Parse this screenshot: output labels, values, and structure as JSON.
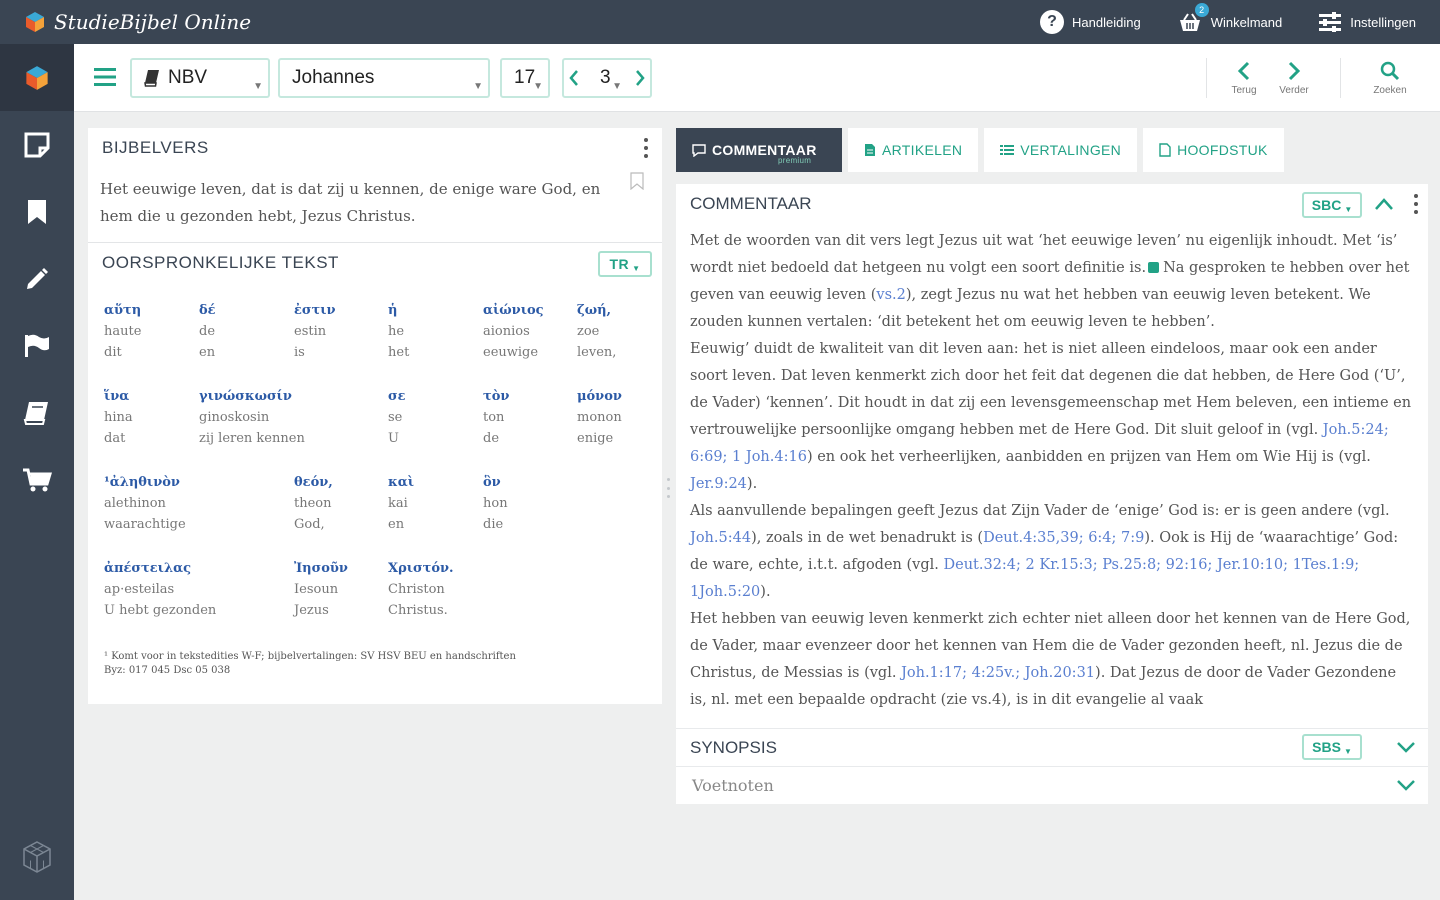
{
  "app": {
    "title": "StudieBijbel Online"
  },
  "topbar": {
    "help_label": "Handleiding",
    "cart_label": "Winkelmand",
    "cart_count": "2",
    "settings_label": "Instellingen"
  },
  "sidebar": {
    "items": [
      "logo",
      "notes",
      "bookmarks",
      "edit",
      "flag",
      "books",
      "cart"
    ]
  },
  "toolbar": {
    "translation": "NBV",
    "book": "Johannes",
    "chapter": "17",
    "verse": "3",
    "back_label": "Terug",
    "forward_label": "Verder",
    "search_label": "Zoeken"
  },
  "left": {
    "verse_title": "BIJBELVERS",
    "verse_text": "Het eeuwige leven, dat is dat zij u kennen, de enige ware God, en hem die u gezonden hebt, Jezus Christus.",
    "orig_title": "OORSPRONKELIJKE TEKST",
    "orig_badge": "TR",
    "words": [
      {
        "g": "αὕτη",
        "t": "haute",
        "d": "dit"
      },
      {
        "g": "δέ",
        "t": "de",
        "d": "en"
      },
      {
        "g": "ἐστιν",
        "t": "estin",
        "d": "is"
      },
      {
        "g": "ἡ",
        "t": "he",
        "d": "het"
      },
      {
        "g": "αἰώνιος",
        "t": "aionios",
        "d": "eeuwige"
      },
      {
        "g": "ζωή,",
        "t": "zoe",
        "d": "leven,"
      },
      {
        "g": "ἵνα",
        "t": "hina",
        "d": "dat"
      },
      {
        "g": "γινώσκωσίν",
        "t": "ginoskosin",
        "d": "zij leren kennen"
      },
      {
        "g": "σε",
        "t": "se",
        "d": "U"
      },
      {
        "g": "τὸν",
        "t": "ton",
        "d": "de"
      },
      {
        "g": "μόνον",
        "t": "monon",
        "d": "enige"
      },
      {
        "g": "¹ἀληθινὸν",
        "t": "alethinon",
        "d": "waarachtige"
      },
      {
        "g": "θεόν,",
        "t": "theon",
        "d": "God,"
      },
      {
        "g": "καὶ",
        "t": "kai",
        "d": "en"
      },
      {
        "g": "ὃν",
        "t": "hon",
        "d": "die"
      },
      {
        "g": "ἀπέστειλας",
        "t": "ap·esteilas",
        "d": "U hebt gezonden"
      },
      {
        "g": "Ἰησοῦν",
        "t": "Iesoun",
        "d": "Jezus"
      },
      {
        "g": "Χριστόν.",
        "t": "Christon",
        "d": "Christus."
      }
    ],
    "footnote": "¹ Komt voor in tekstedities W-F; bijbelvertalingen: SV HSV BEU en handschriften Byz: 017 045 Dsc 05 038"
  },
  "tabs": [
    {
      "label": "COMMENTAAR",
      "sub": "premium"
    },
    {
      "label": "ARTIKELEN"
    },
    {
      "label": "VERTALINGEN"
    },
    {
      "label": "HOOFDSTUK"
    }
  ],
  "commentary": {
    "title": "COMMENTAAR",
    "badge": "SBC",
    "p1a": "Met de woorden van dit vers legt Jezus uit wat ‘het eeuwige leven’ nu eigenlijk inhoudt. Met ‘is’ wordt niet bedoeld dat hetgeen nu volgt een soort definitie is.",
    "p1b": "Na gesproken te hebben over het geven van eeuwig leven (",
    "p1_link": "vs.2",
    "p1c": "), zegt Jezus nu wat het hebben van eeuwig leven betekent. We zouden kunnen vertalen: ‘dit betekent het om eeuwig leven te hebben’.",
    "p2a": "Eeuwig’ duidt de kwaliteit van dit leven aan: het is niet alleen eindeloos, maar ook een ander soort leven. Dat leven kenmerkt zich door het feit dat degenen die dat hebben, de Here God (‘U’, de Vader) ‘kennen’. Dit houdt in dat zij een levensgemeenschap met Hem beleven, een intieme en vertrouwelijke persoonlijke omgang hebben met de Here God. Dit sluit geloof in (vgl.",
    "p2_link1": "Joh.5:24; 6:69; 1 Joh.4:16",
    "p2b": ") en ook het verheerlijken, aanbidden en prijzen van Hem om Wie Hij is (vgl.",
    "p2_link2": "Jer.9:24",
    "p2c": ").",
    "p3a": "Als aanvullende bepalingen geeft Jezus dat Zijn Vader de ‘enige’ God is: er is geen andere (vgl.",
    "p3_link1": "Joh.5:44",
    "p3b": "), zoals in de wet benadrukt is (",
    "p3_link2": "Deut.4:35,39; 6:4; 7:9",
    "p3c": "). Ook is Hij de ‘waarachtige’ God: de ware, echte, i.t.t. afgoden (vgl.",
    "p3_link3": "Deut.32:4; 2 Kr.15:3; Ps.25:8; 92:16; Jer.10:10; 1Tes.1:9; 1Joh.5:20",
    "p3d": ").",
    "p4a": "Het hebben van eeuwig leven kenmerkt zich echter niet alleen door het kennen van de Here God, de Vader, maar evenzeer door het kennen van Hem die de Vader gezonden heeft, nl. Jezus die de Christus, de Messias is (vgl.",
    "p4_link": "Joh.1:17; 4:25v.; Joh.20:31",
    "p4b": "). Dat Jezus de door de Vader Gezondene is, nl. met een bepaalde opdracht (zie vs.4), is in dit evangelie al vaak"
  },
  "synopsis": {
    "title": "SYNOPSIS",
    "badge": "SBS"
  },
  "footnotes": {
    "title": "Voetnoten"
  },
  "colors": {
    "accent": "#22a286",
    "dark": "#3a4553",
    "link": "#5a7fd0",
    "greek": "#2c5aa6"
  }
}
